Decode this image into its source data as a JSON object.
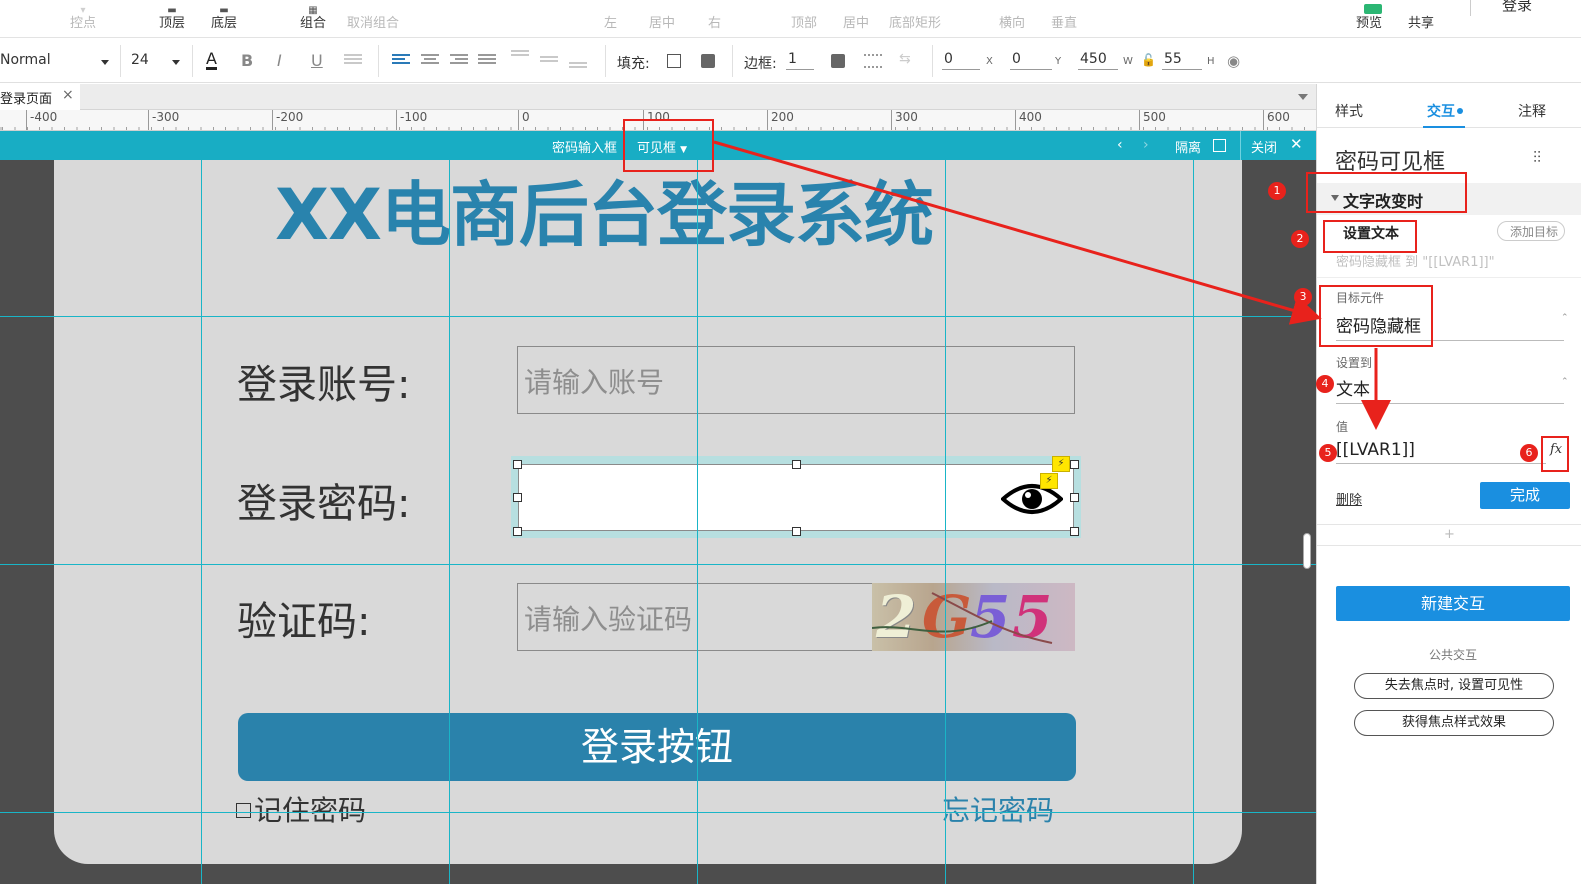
{
  "toolbar": {
    "anchor": "控点",
    "top_layer": "顶层",
    "bottom_layer": "底层",
    "group": "组合",
    "ungroup": "取消组合",
    "left": "左",
    "center": "居中",
    "right": "右",
    "top": "顶部",
    "middle": "居中",
    "bottom": "底部矩形",
    "horizontal": "横向",
    "vertical": "垂直",
    "preview": "预览",
    "share": "共享",
    "login": "登录"
  },
  "format": {
    "style": "Normal",
    "font_size": "24",
    "fill_label": "填充:",
    "border_label": "边框:",
    "border_value": "1",
    "x": "0",
    "x_label": "X",
    "y": "0",
    "y_label": "Y",
    "w": "450",
    "w_label": "W",
    "h": "55",
    "h_label": "H",
    "bold": "B",
    "italic": "I",
    "underline": "U",
    "font_color": "A"
  },
  "tabbar": {
    "page_tab": "登录页面",
    "close": "×"
  },
  "ruler": {
    "labels": [
      "-400",
      "-300",
      "-200",
      "-100",
      "0",
      "100",
      "200",
      "300",
      "400",
      "500",
      "600"
    ]
  },
  "hidden_bar": {
    "prefix": "密码输入框",
    "state": "可见框",
    "isolate": "隔离",
    "close": "关闭",
    "prev": "‹",
    "next": "›",
    "close_icon": "✕"
  },
  "canvas": {
    "title": "XX电商后台登录系统",
    "account_label": "登录账号:",
    "account_placeholder": "请输入账号",
    "password_label": "登录密码:",
    "captcha_label": "验证码:",
    "captcha_placeholder": "请输入验证码",
    "captcha_chars": [
      "2",
      "G",
      "5",
      "5"
    ],
    "login_button": "登录按钮",
    "remember": "记住密码",
    "forgot": "忘记密码",
    "eye_icon": "eye-icon"
  },
  "panel": {
    "tab_style": "样式",
    "tab_interact": "交互",
    "tab_notes": "注释",
    "widget_name": "密码可见框",
    "event": "文字改变时",
    "action": "设置文本",
    "add_target": "添加目标",
    "action_desc": "密码隐藏框 到 \"[[LVAR1]]\"",
    "target_label": "目标元件",
    "target_value": "密码隐藏框",
    "set_to_label": "设置到",
    "set_to_value": "文本",
    "value_label": "值",
    "value_value": "[[LVAR1]]",
    "fx": "fx",
    "delete": "删除",
    "done": "完成",
    "add": "+",
    "new_interaction": "新建交互",
    "common_title": "公共交互",
    "common1": "失去焦点时, 设置可见性",
    "common2": "获得焦点样式效果"
  },
  "annotations": [
    "1",
    "2",
    "3",
    "4",
    "5",
    "6"
  ],
  "colors": {
    "accent": "#1a8fe0",
    "title_blue": "#2983ad",
    "guide": "#19b5c7",
    "annotation_red": "#e8221c"
  }
}
